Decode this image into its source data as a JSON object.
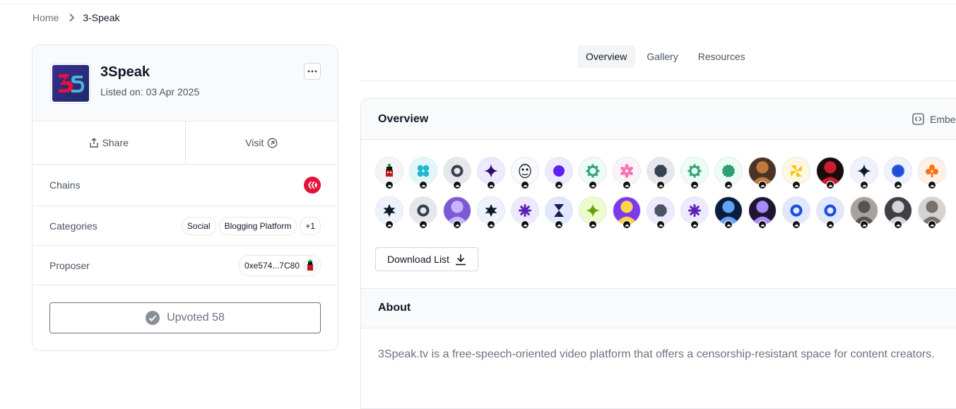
{
  "breadcrumb": {
    "home": "Home",
    "current": "3-Speak"
  },
  "app": {
    "name": "3Speak",
    "listed": "Listed on: 03 Apr 2025"
  },
  "actions": {
    "share": "Share",
    "visit": "Visit"
  },
  "rows": {
    "chains_label": "Chains",
    "categories_label": "Categories",
    "categories": [
      "Social",
      "Blogging Platform",
      "+1"
    ],
    "proposer_label": "Proposer",
    "proposer_address": "0xe574...7C80"
  },
  "upvote": {
    "label": "Upvoted 58"
  },
  "tabs": [
    "Overview",
    "Gallery",
    "Resources"
  ],
  "overview": {
    "title": "Overview",
    "embed_label": "Embed",
    "download_label": "Download List"
  },
  "about": {
    "title": "About",
    "text": "3Speak.tv is a free-speech-oriented video platform that offers a censorship-resistant space for content creators."
  },
  "colors": {
    "hive_red": "#e31337",
    "logo_bg": "#2b2a7a",
    "accent_dark": "#111827"
  },
  "supporters_row1": [
    {
      "icon": "pixel-avatar-icon",
      "bg": "#f3f4f6",
      "fg": "#b91c1c"
    },
    {
      "icon": "blob-icon",
      "bg": "#e0f7fa",
      "fg": "#22b8cf"
    },
    {
      "icon": "ring-icon",
      "bg": "#e5e7eb",
      "fg": "#374151"
    },
    {
      "icon": "sparkle-icon",
      "bg": "#ede9fe",
      "fg": "#2e1065"
    },
    {
      "icon": "sketch-face-icon",
      "bg": "#f9fafb",
      "fg": "#111827"
    },
    {
      "icon": "circle-icon",
      "bg": "#ede9fe",
      "fg": "#5b21f5"
    },
    {
      "icon": "gear-icon",
      "bg": "#ecfdf5",
      "fg": "#34a37b"
    },
    {
      "icon": "flower-icon",
      "bg": "#fdf2f8",
      "fg": "#f472b6"
    },
    {
      "icon": "octagon-icon",
      "bg": "#e5e7eb",
      "fg": "#374151"
    },
    {
      "icon": "gear-icon",
      "bg": "#ecfdf5",
      "fg": "#34a37b"
    },
    {
      "icon": "badge-icon",
      "bg": "#ecfdf5",
      "fg": "#2f9e75"
    },
    {
      "icon": "photo-avatar-icon",
      "bg": "#4b3426",
      "fg": "#c07a3b"
    },
    {
      "icon": "pinwheel-icon",
      "bg": "#fff7e0",
      "fg": "#fac517"
    },
    {
      "icon": "photo-avatar-icon",
      "bg": "#1b0b0f",
      "fg": "#c81e2e"
    },
    {
      "icon": "sparkle-icon",
      "bg": "#eef2ff",
      "fg": "#0f172a"
    },
    {
      "icon": "burst-icon",
      "bg": "#eef2ff",
      "fg": "#1d4ed8"
    },
    {
      "icon": "clover-icon",
      "bg": "#fff1e6",
      "fg": "#f97316"
    }
  ],
  "supporters_row2": [
    {
      "icon": "star-icon",
      "bg": "#eef2ff",
      "fg": "#0f172a"
    },
    {
      "icon": "ring-icon",
      "bg": "#e5e7eb",
      "fg": "#374151"
    },
    {
      "icon": "photo-avatar-icon",
      "bg": "#7c5ad3",
      "fg": "#c4b5fd"
    },
    {
      "icon": "star-icon",
      "bg": "#eef2ff",
      "fg": "#0f172a"
    },
    {
      "icon": "asterisk-icon",
      "bg": "#ede9fe",
      "fg": "#5b21b6"
    },
    {
      "icon": "hourglass-icon",
      "bg": "#e0e7ff",
      "fg": "#1e1b4b"
    },
    {
      "icon": "sparkle-icon",
      "bg": "#ecfccb",
      "fg": "#65a30d"
    },
    {
      "icon": "photo-avatar-icon",
      "bg": "#7c3aed",
      "fg": "#fcd34d"
    },
    {
      "icon": "octagon-icon",
      "bg": "#ede9fe",
      "fg": "#4b5563"
    },
    {
      "icon": "asterisk-icon",
      "bg": "#ede9fe",
      "fg": "#5b21b6"
    },
    {
      "icon": "photo-avatar-icon",
      "bg": "#0b1d3a",
      "fg": "#60a5fa"
    },
    {
      "icon": "photo-avatar-icon",
      "bg": "#1f1533",
      "fg": "#a78bfa"
    },
    {
      "icon": "ring-icon",
      "bg": "#e0e7ff",
      "fg": "#1d4ed8"
    },
    {
      "icon": "ring-icon",
      "bg": "#e0e7ff",
      "fg": "#1d4ed8"
    },
    {
      "icon": "photo-avatar-icon",
      "bg": "#a8a29e",
      "fg": "#57534e"
    },
    {
      "icon": "photo-avatar-icon",
      "bg": "#3f3f46",
      "fg": "#d4d4d8"
    },
    {
      "icon": "photo-avatar-icon",
      "bg": "#d6d3d1",
      "fg": "#78716c"
    }
  ]
}
